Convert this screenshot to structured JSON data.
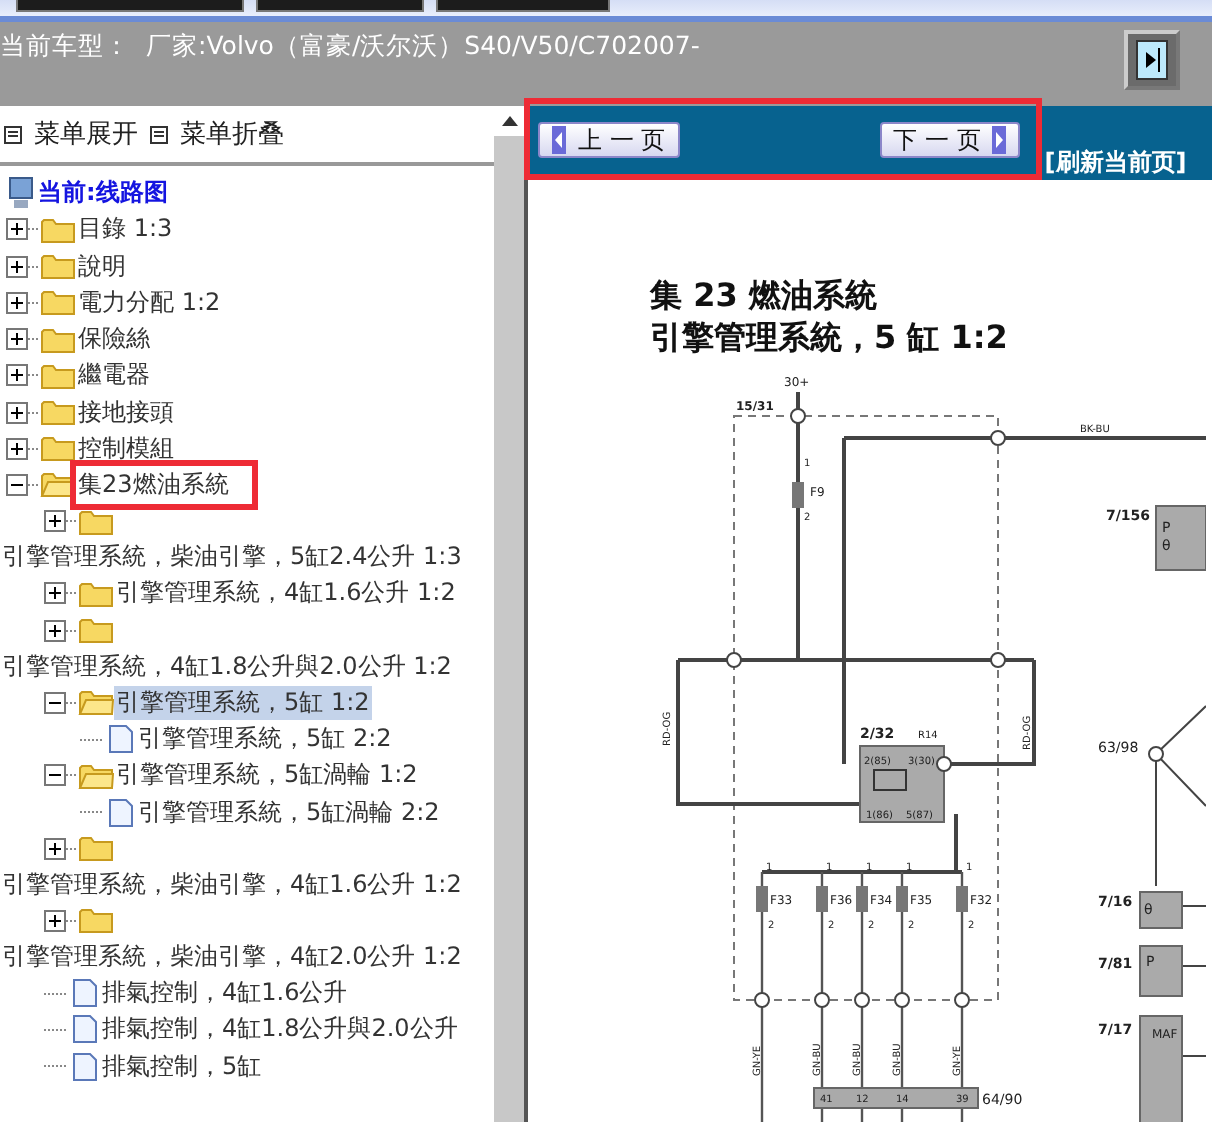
{
  "header": {
    "label": "当前车型：",
    "vehicle": "厂家:Volvo（富豪/沃尔沃）S40/V50/C702007-"
  },
  "menu": [
    {
      "label": "菜单展开"
    },
    {
      "label": "菜单折叠"
    }
  ],
  "tree": {
    "kind": "root",
    "label": "当前:线路图",
    "selected": false,
    "children": [
      {
        "kind": "folder",
        "label": "目錄 1:3",
        "expanded": false,
        "selected": false
      },
      {
        "kind": "folder",
        "label": "說明",
        "expanded": false,
        "selected": false
      },
      {
        "kind": "folder",
        "label": "電力分配 1:2",
        "expanded": false,
        "selected": false
      },
      {
        "kind": "folder",
        "label": "保險絲",
        "expanded": false,
        "selected": false
      },
      {
        "kind": "folder",
        "label": "繼電器",
        "expanded": false,
        "selected": false
      },
      {
        "kind": "folder",
        "label": "接地接頭",
        "expanded": false,
        "selected": false
      },
      {
        "kind": "folder",
        "label": "控制模組",
        "expanded": false,
        "selected": false
      },
      {
        "kind": "folder",
        "label": "集23燃油系統",
        "expanded": true,
        "selected": false,
        "highlighted": true,
        "children": [
          {
            "kind": "folder",
            "label": "引擎管理系統，柴油引擎，5缸2.4公升 1:3",
            "expanded": false,
            "selected": false
          },
          {
            "kind": "folder",
            "label": "引擎管理系統，4缸1.6公升 1:2",
            "expanded": false,
            "selected": false
          },
          {
            "kind": "folder",
            "label": "引擎管理系統，4缸1.8公升與2.0公升 1:2",
            "expanded": false,
            "selected": false
          },
          {
            "kind": "folder",
            "label": "引擎管理系統，5缸 1:2",
            "expanded": true,
            "selected": true,
            "children": [
              {
                "kind": "page",
                "label": "引擎管理系統，5缸 2:2",
                "selected": false
              }
            ]
          },
          {
            "kind": "folder",
            "label": "引擎管理系統，5缸渦輪 1:2",
            "expanded": true,
            "selected": false,
            "children": [
              {
                "kind": "page",
                "label": "引擎管理系統，5缸渦輪 2:2",
                "selected": false
              }
            ]
          },
          {
            "kind": "folder",
            "label": "引擎管理系統，柴油引擎，4缸1.6公升 1:2",
            "expanded": false,
            "selected": false
          },
          {
            "kind": "folder",
            "label": "引擎管理系統，柴油引擎，4缸2.0公升 1:2",
            "expanded": false,
            "selected": false
          },
          {
            "kind": "page",
            "label": "排氣控制，4缸1.6公升",
            "selected": false
          },
          {
            "kind": "page",
            "label": "排氣控制，4缸1.8公升與2.0公升",
            "selected": false
          },
          {
            "kind": "page",
            "label": "排氣控制，5缸",
            "selected": false
          }
        ]
      }
    ]
  },
  "nav": {
    "prev": "上 一 页",
    "next": "下 一 页",
    "refresh": "[刷新当前页]"
  },
  "diagram": {
    "title": [
      "集 23 燃油系統",
      "引擎管理系統，5 缸  1:2"
    ],
    "labels": [
      "30+",
      "15/31",
      "BK-BU",
      "F9",
      "1",
      "2",
      "7/156",
      "RD-OG",
      "RD-OG",
      "2/32",
      "R14",
      "2(85)",
      "3(30)",
      "1(86)",
      "5(87)",
      "63/98",
      "F33",
      "F36",
      "F34",
      "F35",
      "F32",
      "7/16",
      "7/81",
      "7/17",
      "MAF",
      "GN-YE",
      "GN-BU",
      "GN-BU",
      "GN-BU",
      "GN-YE",
      "41",
      "12",
      "14",
      "39",
      "64/90",
      "P",
      "θ",
      "θ",
      "P",
      "1",
      "2",
      "1",
      "2",
      "1",
      "2",
      "1",
      "2",
      "1",
      "2"
    ]
  }
}
